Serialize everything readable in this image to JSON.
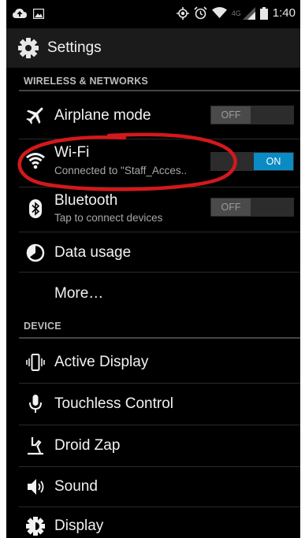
{
  "status_bar": {
    "network_label": "4G",
    "time": "1:40",
    "icons": [
      "cloud-upload-icon",
      "image-icon",
      "gps-icon",
      "alarm-icon",
      "wifi-icon",
      "signal-icon",
      "battery-icon"
    ]
  },
  "action_bar": {
    "title": "Settings",
    "icon": "gear-icon"
  },
  "sections": {
    "wireless": {
      "header": "WIRELESS & NETWORKS",
      "airplane": {
        "label": "Airplane mode",
        "toggle": "OFF",
        "icon": "airplane-icon"
      },
      "wifi": {
        "label": "Wi-Fi",
        "sub": "Connected to \"Staff_Acces..",
        "toggle": "ON",
        "icon": "wifi-icon"
      },
      "bluetooth": {
        "label": "Bluetooth",
        "sub": "Tap to connect devices",
        "toggle": "OFF",
        "icon": "bluetooth-icon"
      },
      "data_usage": {
        "label": "Data usage",
        "icon": "pie-chart-icon"
      },
      "more": {
        "label": "More…"
      }
    },
    "device": {
      "header": "DEVICE",
      "active_display": {
        "label": "Active Display",
        "icon": "active-display-icon"
      },
      "touchless": {
        "label": "Touchless Control",
        "icon": "microphone-icon"
      },
      "droid_zap": {
        "label": "Droid Zap",
        "icon": "zap-gesture-icon"
      },
      "sound": {
        "label": "Sound",
        "icon": "speaker-icon"
      },
      "display": {
        "label": "Display",
        "icon": "brightness-icon"
      }
    }
  },
  "colors": {
    "background": "#000000",
    "action_bar": "#1b1b1b",
    "toggle_on": "#0a8bc4",
    "annotation": "#d4181c"
  }
}
